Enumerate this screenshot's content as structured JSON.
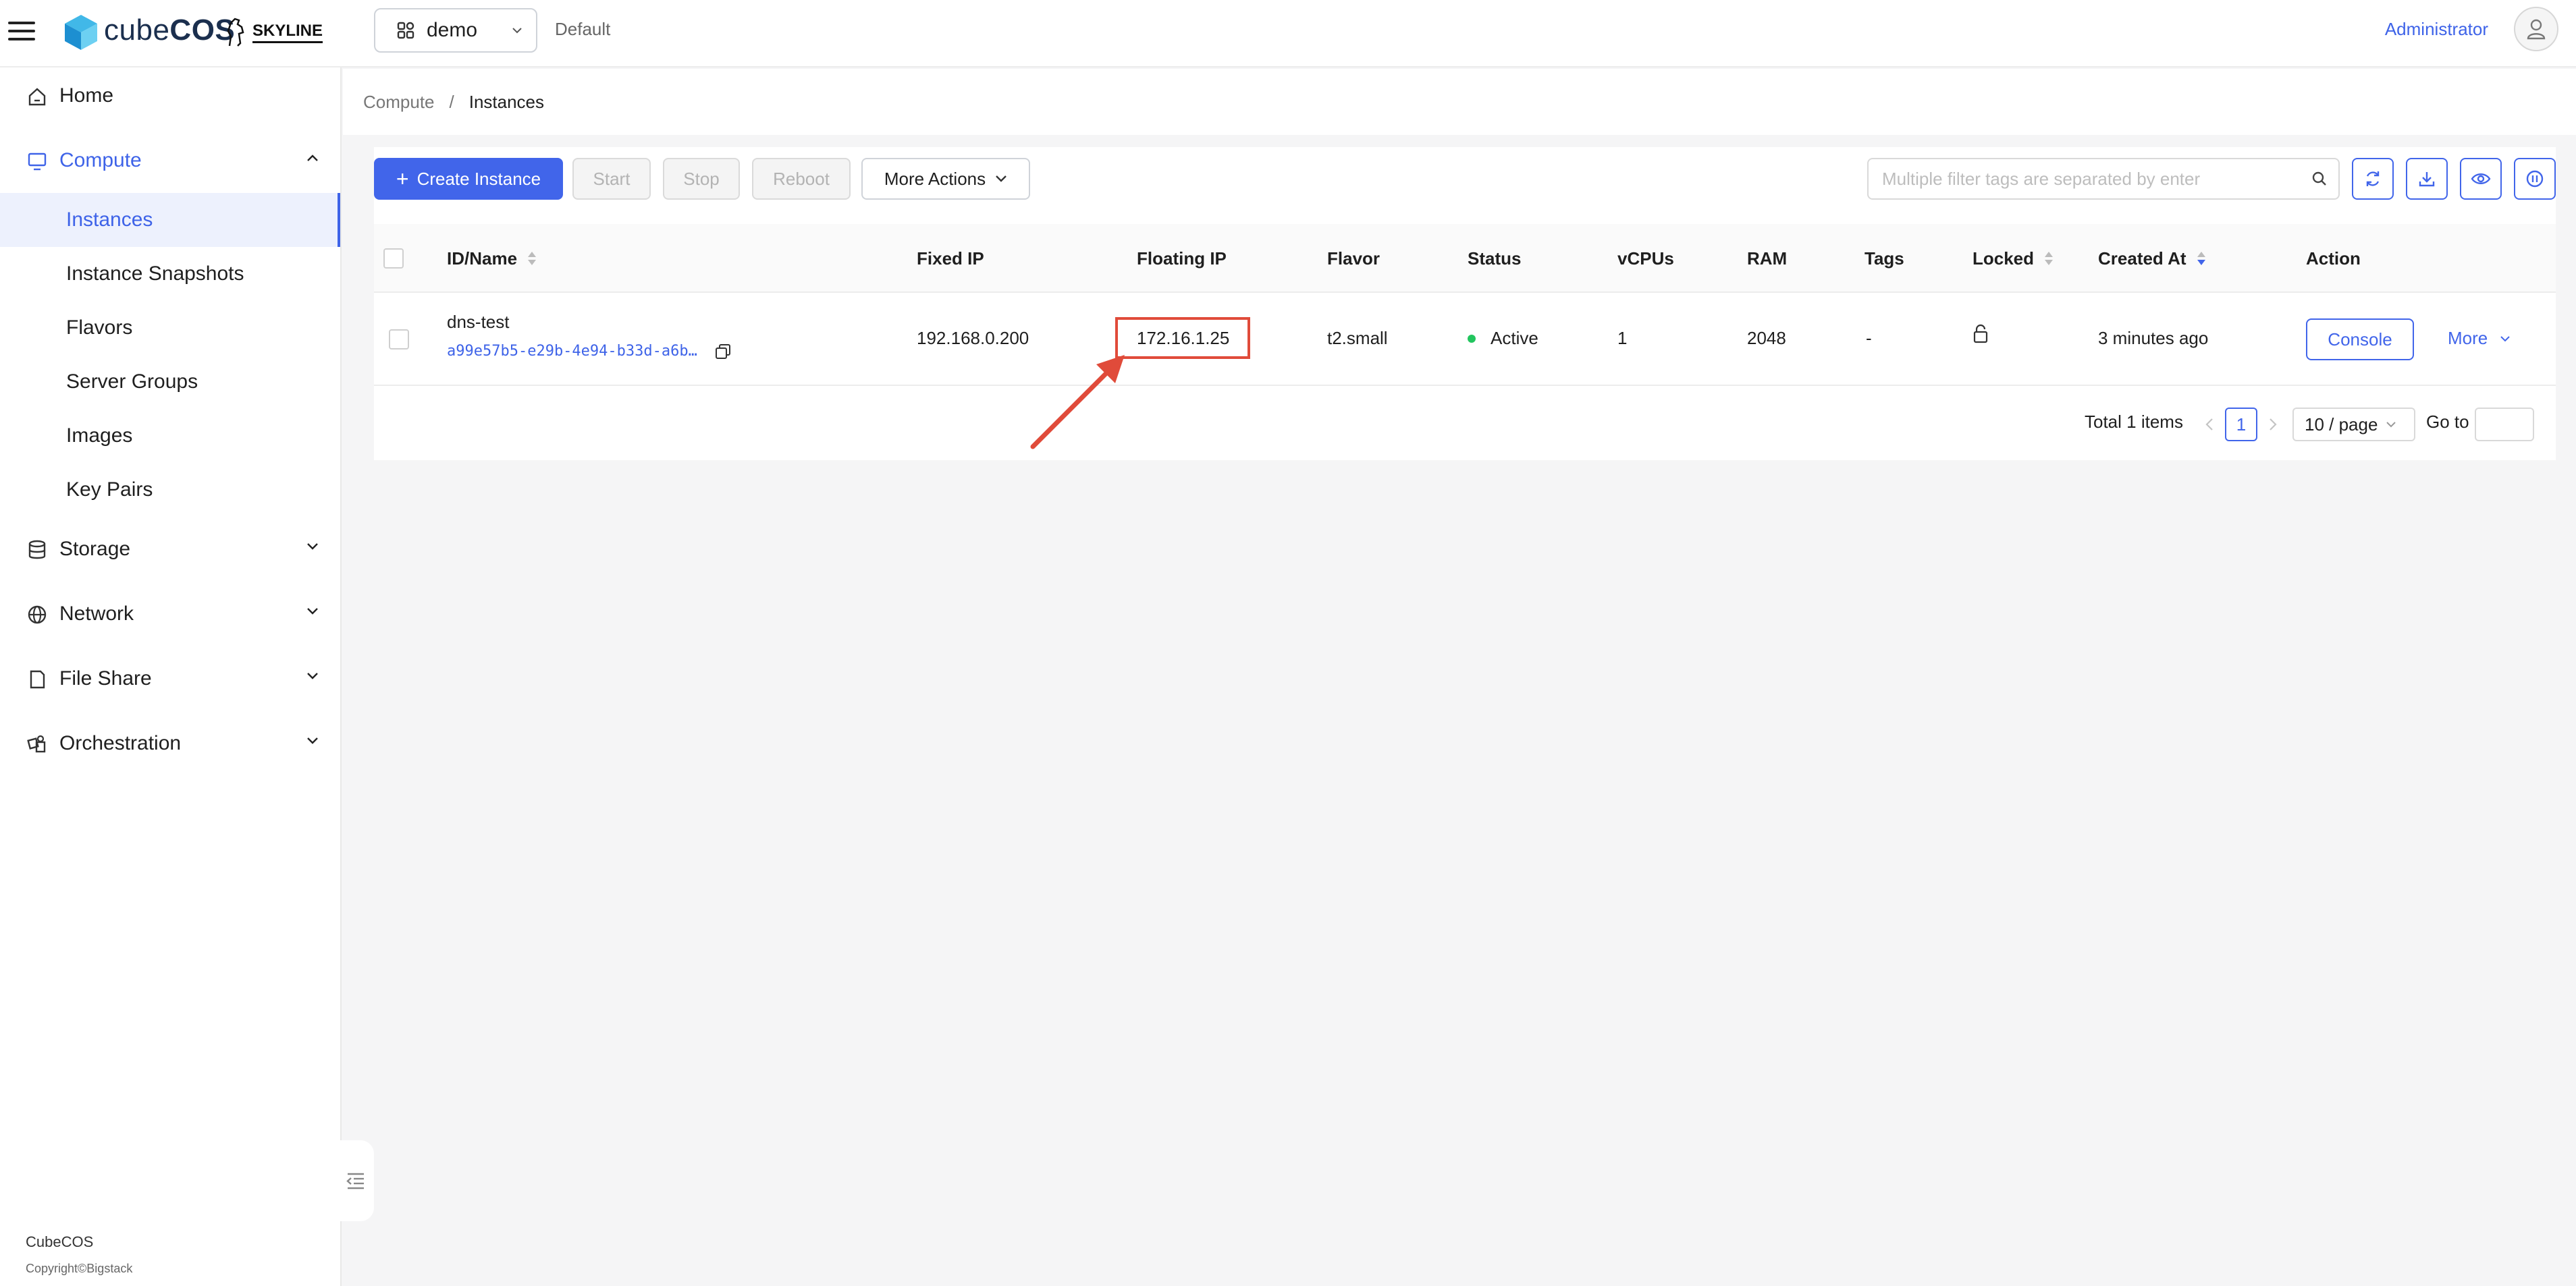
{
  "header": {
    "brand_prefix": "cube",
    "brand_suffix": "COS",
    "partner_logo": "SKYLINE",
    "project": "demo",
    "domain": "Default",
    "user": "Administrator"
  },
  "sidebar": {
    "items": [
      {
        "label": "Home",
        "icon": "home-icon"
      },
      {
        "label": "Compute",
        "icon": "monitor-icon",
        "expanded": true,
        "children": [
          "Instances",
          "Instance Snapshots",
          "Flavors",
          "Server Groups",
          "Images",
          "Key Pairs"
        ]
      },
      {
        "label": "Storage",
        "icon": "database-icon"
      },
      {
        "label": "Network",
        "icon": "globe-icon"
      },
      {
        "label": "File Share",
        "icon": "file-icon"
      },
      {
        "label": "Orchestration",
        "icon": "orchestration-icon"
      }
    ],
    "selected": "Instances",
    "footer_brand": "CubeCOS",
    "footer_copy": "Copyright©Bigstack"
  },
  "breadcrumb": {
    "parent": "Compute",
    "separator": "/",
    "current": "Instances"
  },
  "toolbar": {
    "create_label": "Create Instance",
    "start_label": "Start",
    "stop_label": "Stop",
    "reboot_label": "Reboot",
    "more_actions_label": "More Actions",
    "filter_placeholder": "Multiple filter tags are separated by enter"
  },
  "table": {
    "columns": [
      "ID/Name",
      "Fixed IP",
      "Floating IP",
      "Flavor",
      "Status",
      "vCPUs",
      "RAM",
      "Tags",
      "Locked",
      "Created At",
      "Action"
    ],
    "rows": [
      {
        "name": "dns-test",
        "id": "a99e57b5-e29b-4e94-b33d-a6b…",
        "fixed_ip": "192.168.0.200",
        "floating_ip": "172.16.1.25",
        "flavor": "t2.small",
        "status": "Active",
        "vcpus": "1",
        "ram": "2048",
        "tags": "-",
        "locked": "unlocked",
        "created_at": "3 minutes ago",
        "console_label": "Console",
        "more_label": "More"
      }
    ]
  },
  "pagination": {
    "total_text": "Total 1 items",
    "current_page": "1",
    "page_size": "10 / page",
    "goto_label": "Go to"
  },
  "colors": {
    "accent": "#4165ea",
    "status_active": "#22c55e",
    "annotation": "#e04b3a"
  }
}
